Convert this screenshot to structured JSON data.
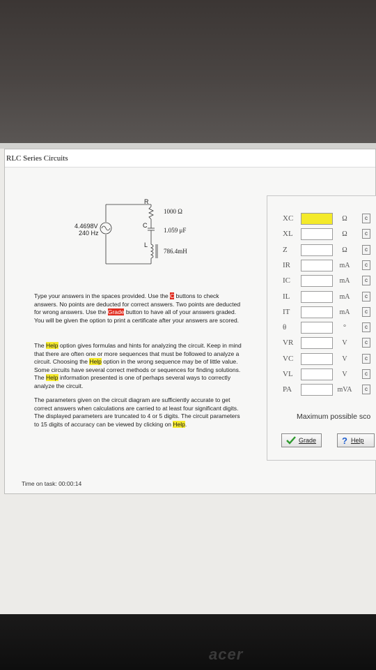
{
  "window": {
    "title": "RLC Series Circuits"
  },
  "monitor": {
    "brand": "acer"
  },
  "circuit": {
    "r_label": "R",
    "c_label": "C",
    "l_label": "L",
    "resistance": "1000 Ω",
    "capacitance": "1.059 μF",
    "inductance": "786.4mH",
    "source_voltage": "4.4698V",
    "source_frequency": "240 Hz"
  },
  "instructions": {
    "p1": {
      "a": "Type your answers in the spaces provided. Use the ",
      "c_hl": "C",
      "b": " buttons to check answers. No points are deducted for correct answers. Two points are deducted for wrong answers. Use the ",
      "grade_hl": "Grade",
      "c": " button to have all of your answers graded. You will be given the option to print a certificate after your answers are scored."
    },
    "p2": {
      "a": "The ",
      "help1": "Help",
      "b": " option gives formulas and hints for analyzing the circuit. Keep in mind that there are often one or more sequences that must be followed to analyze a circuit. Choosing the ",
      "help2": "Help",
      "c": " option in the wrong sequence may be of little value. Some circuits have several correct methods or sequences for finding solutions. The ",
      "help3": "Help",
      "d": " information presented is one of perhaps several ways to correctly analyze the circuit."
    },
    "p3": {
      "a": "The parameters given on the circuit diagram are sufficiently accurate to get correct answers when calculations are carried to at least four significant digits. The displayed parameters are truncated to 4 or 5 digits. The circuit parameters to 15 digits of accuracy can be viewed by clicking on ",
      "help": "Help",
      "b": "."
    }
  },
  "timer": {
    "label": "Time on task:",
    "value": "00:00:14"
  },
  "answers": [
    {
      "label": "XC",
      "unit": "Ω",
      "check": "c",
      "value": ""
    },
    {
      "label": "XL",
      "unit": "Ω",
      "check": "c",
      "value": ""
    },
    {
      "label": "Z",
      "unit": "Ω",
      "check": "c",
      "value": ""
    },
    {
      "label": "IR",
      "unit": "mA",
      "check": "c",
      "value": ""
    },
    {
      "label": "IC",
      "unit": "mA",
      "check": "c",
      "value": ""
    },
    {
      "label": "IL",
      "unit": "mA",
      "check": "c",
      "value": ""
    },
    {
      "label": "IT",
      "unit": "mA",
      "check": "c",
      "value": ""
    },
    {
      "label": "θ",
      "unit": "°",
      "check": "c",
      "value": ""
    },
    {
      "label": "VR",
      "unit": "V",
      "check": "c",
      "value": ""
    },
    {
      "label": "VC",
      "unit": "V",
      "check": "c",
      "value": ""
    },
    {
      "label": "VL",
      "unit": "V",
      "check": "c",
      "value": ""
    },
    {
      "label": "PA",
      "unit": "mVA",
      "check": "c",
      "value": ""
    }
  ],
  "score": {
    "label": "Maximum possible sco"
  },
  "buttons": {
    "grade": "Grade",
    "help": "Help",
    "grade_icon": "check-icon",
    "help_icon": "question-icon"
  },
  "colors": {
    "highlight_yellow": "#f5ea2c",
    "highlight_red": "#e12a1d",
    "check_green": "#2e9a2e",
    "help_blue": "#1f5fcf"
  }
}
